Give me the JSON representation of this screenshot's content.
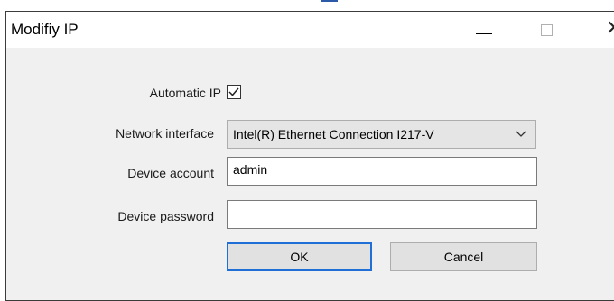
{
  "window": {
    "title": "Modifiy IP",
    "controls": {
      "minimize": "minimize-icon",
      "maximize": "maximize-icon",
      "close": "close-icon"
    }
  },
  "form": {
    "automatic_ip_label": "Automatic IP",
    "automatic_ip_checked": true,
    "network_interface_label": "Network interface",
    "network_interface_value": "Intel(R) Ethernet Connection I217-V",
    "device_account_label": "Device account",
    "device_account_value": "admin",
    "device_password_label": "Device password",
    "device_password_value": ""
  },
  "buttons": {
    "ok": "OK",
    "cancel": "Cancel"
  },
  "colors": {
    "focus_border": "#1f6fd6",
    "dialog_bg": "#f0f0f0"
  }
}
